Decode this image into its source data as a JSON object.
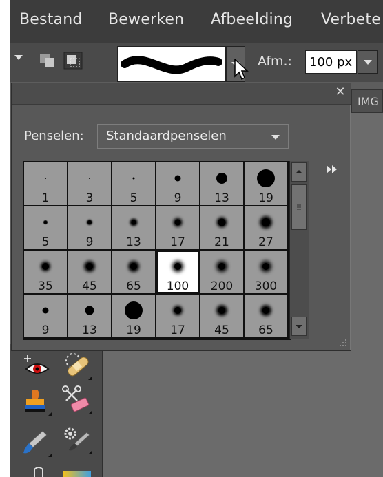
{
  "menu": {
    "items": [
      {
        "label": "Bestand"
      },
      {
        "label": "Bewerken"
      },
      {
        "label": "Afbeelding"
      },
      {
        "label": "Verbete"
      }
    ]
  },
  "options_bar": {
    "size_label": "Afm.:",
    "size_value": "100 px"
  },
  "document_tab": {
    "label": "IMG"
  },
  "brush_picker": {
    "label": "Penselen:",
    "set_value": "Standaardpenselen",
    "brushes": [
      {
        "size": "1"
      },
      {
        "size": "3"
      },
      {
        "size": "5"
      },
      {
        "size": "9"
      },
      {
        "size": "13"
      },
      {
        "size": "19"
      },
      {
        "size": "5"
      },
      {
        "size": "9"
      },
      {
        "size": "13"
      },
      {
        "size": "17"
      },
      {
        "size": "21"
      },
      {
        "size": "27"
      },
      {
        "size": "35"
      },
      {
        "size": "45"
      },
      {
        "size": "65"
      },
      {
        "size": "100"
      },
      {
        "size": "200"
      },
      {
        "size": "300"
      },
      {
        "size": "9"
      },
      {
        "size": "13"
      },
      {
        "size": "19"
      },
      {
        "size": "17"
      },
      {
        "size": "45"
      },
      {
        "size": "65"
      }
    ],
    "selected_index": 15
  },
  "colors": {
    "menubar_bg": "#3c3c3c",
    "panel_bg": "#585858",
    "cell_bg": "#9a9a9a",
    "selected_bg": "#ffffff"
  },
  "icons": {
    "close": "close-icon",
    "flyout": "fast-forward-icon",
    "dropdown": "chevron-down-icon"
  }
}
